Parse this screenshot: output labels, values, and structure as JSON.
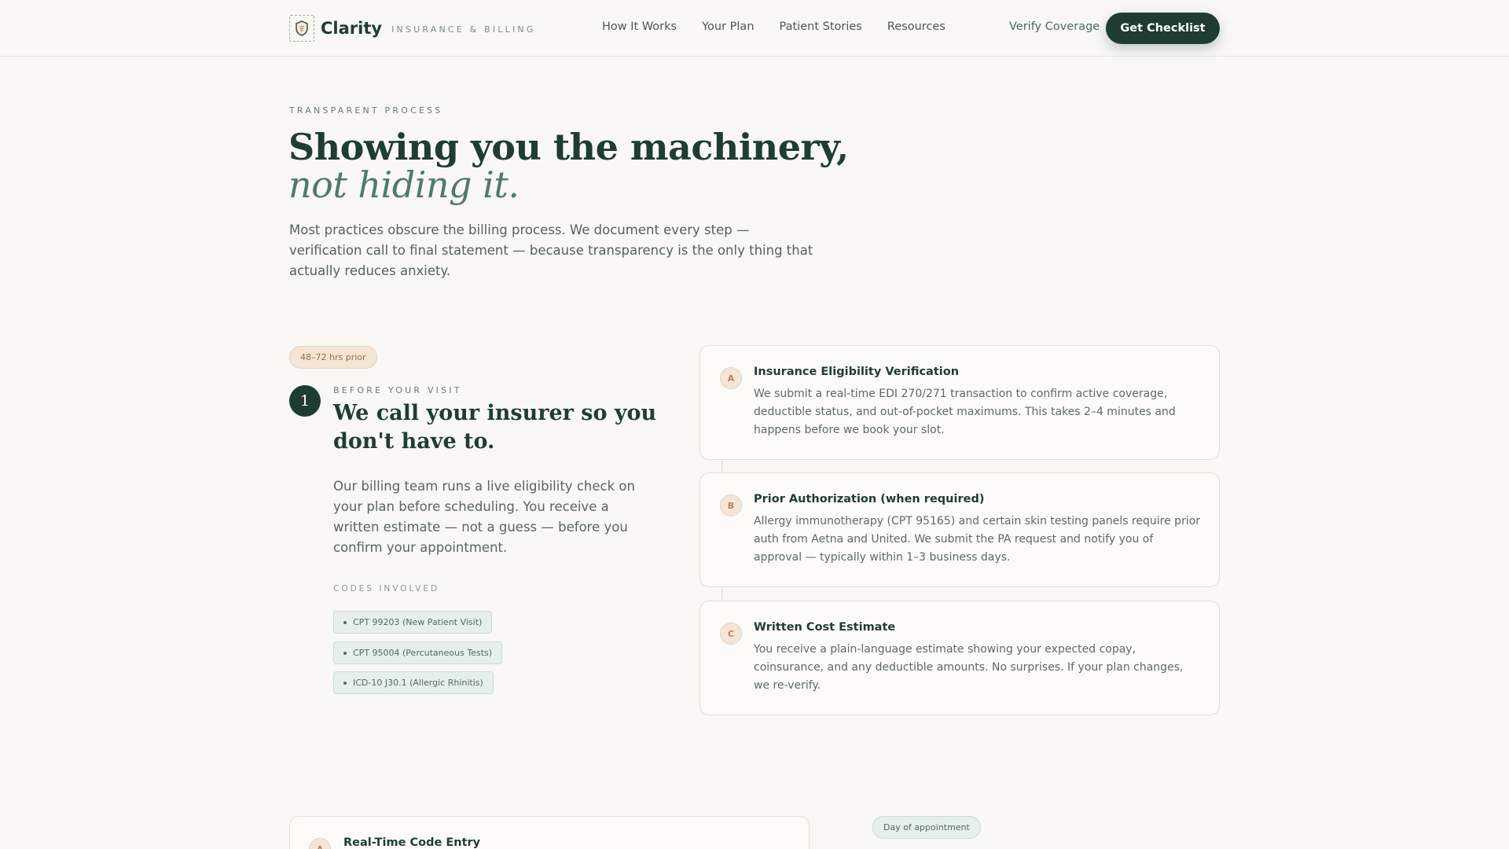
{
  "header": {
    "brand_name": "Clarity",
    "brand_tagline": "INSURANCE & BILLING",
    "logo_icon": "shield-icon",
    "nav": [
      "How It Works",
      "Your Plan",
      "Patient Stories",
      "Resources"
    ],
    "verify_link": "Verify Coverage",
    "cta_label": "Get Checklist"
  },
  "hero": {
    "eyebrow": "TRANSPARENT PROCESS",
    "title_line1": "Showing you the machinery,",
    "title_line2": "not hiding it.",
    "lede": "Most practices obscure the billing process. We document every step — verification call to final statement — because transparency is the only thing that actually reduces anxiety."
  },
  "step1": {
    "timing": "48–72 hrs prior",
    "number": "1",
    "eyebrow": "BEFORE YOUR VISIT",
    "title": "We call your insurer so you don't have to.",
    "body": "Our billing team runs a live eligibility check on your plan before scheduling. You receive a written estimate — not a guess — before you confirm your appointment.",
    "codes_label": "CODES INVOLVED",
    "codes": [
      "CPT 99203 (New Patient Visit)",
      "CPT 95004 (Percutaneous Tests)",
      "ICD-10 J30.1 (Allergic Rhinitis)"
    ],
    "cards": [
      {
        "letter": "A",
        "title": "Insurance Eligibility Verification",
        "desc": "We submit a real-time EDI 270/271 transaction to confirm active coverage, deductible status, and out-of-pocket maximums. This takes 2–4 minutes and happens before we book your slot."
      },
      {
        "letter": "B",
        "title": "Prior Authorization (when required)",
        "desc": "Allergy immunotherapy (CPT 95165) and certain skin testing panels require prior auth from Aetna and United. We submit the PA request and notify you of approval — typically within 1–3 business days."
      },
      {
        "letter": "C",
        "title": "Written Cost Estimate",
        "desc": "You receive a plain-language estimate showing your expected copay, coinsurance, and any deductible amounts. No surprises. If your plan changes, we re-verify."
      }
    ]
  },
  "step2": {
    "timing": "Day of appointment",
    "card_letter": "A",
    "card_title": "Real-Time Code Entry"
  },
  "colors": {
    "brand_green": "#1e3d2f",
    "accent_teal": "#4e7a6c",
    "peach": "#f5e5d6",
    "background": "#f9f8f4"
  }
}
